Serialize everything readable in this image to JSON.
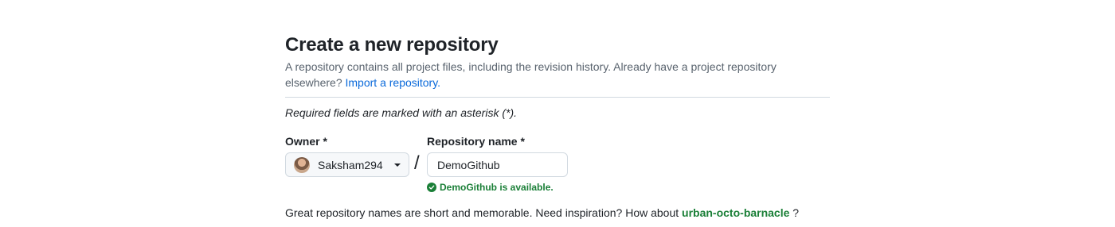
{
  "page": {
    "title": "Create a new repository",
    "description": "A repository contains all project files, including the revision history. Already have a project repository elsewhere?",
    "import_link": "Import a repository.",
    "required_note": "Required fields are marked with an asterisk (*)."
  },
  "form": {
    "owner_label": "Owner *",
    "owner_value": "Saksham294",
    "separator": "/",
    "repo_label": "Repository name *",
    "repo_value": "DemoGithub",
    "availability": "DemoGithub is available."
  },
  "suggestion": {
    "prefix": "Great repository names are short and memorable. Need inspiration? How about",
    "name": "urban-octo-barnacle",
    "suffix": "?"
  },
  "colors": {
    "link": "#0969da",
    "success": "#1a7f37",
    "border": "#d1d9e0"
  },
  "icons": {
    "owner_avatar": "avatar",
    "owner_dropdown": "caret-down-icon",
    "availability": "check-circle-icon"
  }
}
